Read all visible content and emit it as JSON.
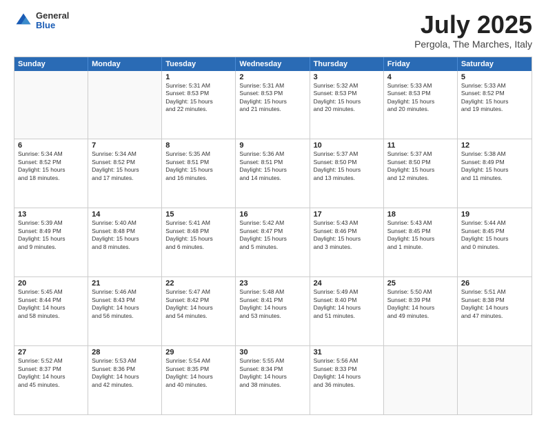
{
  "header": {
    "logo_general": "General",
    "logo_blue": "Blue",
    "month_title": "July 2025",
    "subtitle": "Pergola, The Marches, Italy"
  },
  "weekdays": [
    "Sunday",
    "Monday",
    "Tuesday",
    "Wednesday",
    "Thursday",
    "Friday",
    "Saturday"
  ],
  "rows": [
    [
      {
        "day": "",
        "info": ""
      },
      {
        "day": "",
        "info": ""
      },
      {
        "day": "1",
        "info": "Sunrise: 5:31 AM\nSunset: 8:53 PM\nDaylight: 15 hours\nand 22 minutes."
      },
      {
        "day": "2",
        "info": "Sunrise: 5:31 AM\nSunset: 8:53 PM\nDaylight: 15 hours\nand 21 minutes."
      },
      {
        "day": "3",
        "info": "Sunrise: 5:32 AM\nSunset: 8:53 PM\nDaylight: 15 hours\nand 20 minutes."
      },
      {
        "day": "4",
        "info": "Sunrise: 5:33 AM\nSunset: 8:53 PM\nDaylight: 15 hours\nand 20 minutes."
      },
      {
        "day": "5",
        "info": "Sunrise: 5:33 AM\nSunset: 8:52 PM\nDaylight: 15 hours\nand 19 minutes."
      }
    ],
    [
      {
        "day": "6",
        "info": "Sunrise: 5:34 AM\nSunset: 8:52 PM\nDaylight: 15 hours\nand 18 minutes."
      },
      {
        "day": "7",
        "info": "Sunrise: 5:34 AM\nSunset: 8:52 PM\nDaylight: 15 hours\nand 17 minutes."
      },
      {
        "day": "8",
        "info": "Sunrise: 5:35 AM\nSunset: 8:51 PM\nDaylight: 15 hours\nand 16 minutes."
      },
      {
        "day": "9",
        "info": "Sunrise: 5:36 AM\nSunset: 8:51 PM\nDaylight: 15 hours\nand 14 minutes."
      },
      {
        "day": "10",
        "info": "Sunrise: 5:37 AM\nSunset: 8:50 PM\nDaylight: 15 hours\nand 13 minutes."
      },
      {
        "day": "11",
        "info": "Sunrise: 5:37 AM\nSunset: 8:50 PM\nDaylight: 15 hours\nand 12 minutes."
      },
      {
        "day": "12",
        "info": "Sunrise: 5:38 AM\nSunset: 8:49 PM\nDaylight: 15 hours\nand 11 minutes."
      }
    ],
    [
      {
        "day": "13",
        "info": "Sunrise: 5:39 AM\nSunset: 8:49 PM\nDaylight: 15 hours\nand 9 minutes."
      },
      {
        "day": "14",
        "info": "Sunrise: 5:40 AM\nSunset: 8:48 PM\nDaylight: 15 hours\nand 8 minutes."
      },
      {
        "day": "15",
        "info": "Sunrise: 5:41 AM\nSunset: 8:48 PM\nDaylight: 15 hours\nand 6 minutes."
      },
      {
        "day": "16",
        "info": "Sunrise: 5:42 AM\nSunset: 8:47 PM\nDaylight: 15 hours\nand 5 minutes."
      },
      {
        "day": "17",
        "info": "Sunrise: 5:43 AM\nSunset: 8:46 PM\nDaylight: 15 hours\nand 3 minutes."
      },
      {
        "day": "18",
        "info": "Sunrise: 5:43 AM\nSunset: 8:45 PM\nDaylight: 15 hours\nand 1 minute."
      },
      {
        "day": "19",
        "info": "Sunrise: 5:44 AM\nSunset: 8:45 PM\nDaylight: 15 hours\nand 0 minutes."
      }
    ],
    [
      {
        "day": "20",
        "info": "Sunrise: 5:45 AM\nSunset: 8:44 PM\nDaylight: 14 hours\nand 58 minutes."
      },
      {
        "day": "21",
        "info": "Sunrise: 5:46 AM\nSunset: 8:43 PM\nDaylight: 14 hours\nand 56 minutes."
      },
      {
        "day": "22",
        "info": "Sunrise: 5:47 AM\nSunset: 8:42 PM\nDaylight: 14 hours\nand 54 minutes."
      },
      {
        "day": "23",
        "info": "Sunrise: 5:48 AM\nSunset: 8:41 PM\nDaylight: 14 hours\nand 53 minutes."
      },
      {
        "day": "24",
        "info": "Sunrise: 5:49 AM\nSunset: 8:40 PM\nDaylight: 14 hours\nand 51 minutes."
      },
      {
        "day": "25",
        "info": "Sunrise: 5:50 AM\nSunset: 8:39 PM\nDaylight: 14 hours\nand 49 minutes."
      },
      {
        "day": "26",
        "info": "Sunrise: 5:51 AM\nSunset: 8:38 PM\nDaylight: 14 hours\nand 47 minutes."
      }
    ],
    [
      {
        "day": "27",
        "info": "Sunrise: 5:52 AM\nSunset: 8:37 PM\nDaylight: 14 hours\nand 45 minutes."
      },
      {
        "day": "28",
        "info": "Sunrise: 5:53 AM\nSunset: 8:36 PM\nDaylight: 14 hours\nand 42 minutes."
      },
      {
        "day": "29",
        "info": "Sunrise: 5:54 AM\nSunset: 8:35 PM\nDaylight: 14 hours\nand 40 minutes."
      },
      {
        "day": "30",
        "info": "Sunrise: 5:55 AM\nSunset: 8:34 PM\nDaylight: 14 hours\nand 38 minutes."
      },
      {
        "day": "31",
        "info": "Sunrise: 5:56 AM\nSunset: 8:33 PM\nDaylight: 14 hours\nand 36 minutes."
      },
      {
        "day": "",
        "info": ""
      },
      {
        "day": "",
        "info": ""
      }
    ]
  ]
}
